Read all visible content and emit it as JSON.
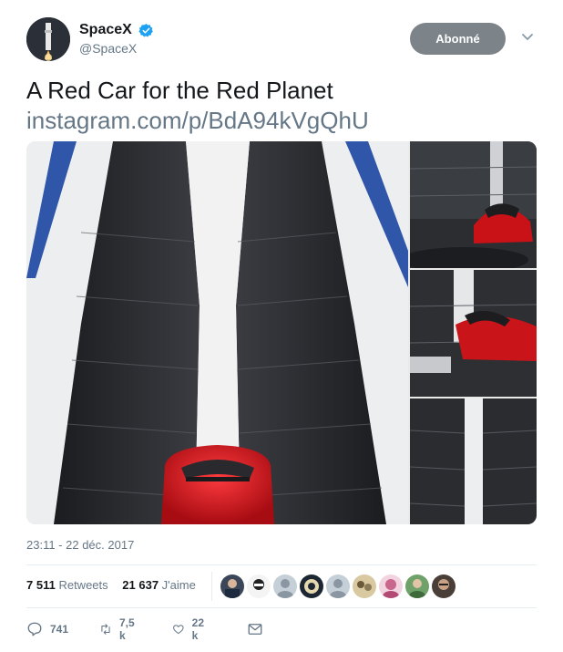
{
  "header": {
    "display_name": "SpaceX",
    "handle": "@SpaceX",
    "follow_label": "Abonné",
    "verified": true
  },
  "tweet": {
    "text": "A Red Car for the Red Planet",
    "link": "instagram.com/p/BdA94kVgQhU",
    "timestamp": "23:11 - 22 déc. 2017"
  },
  "stats": {
    "retweets_count": "7 511",
    "retweets_label": "Retweets",
    "likes_count": "21 637",
    "likes_label": "J'aime"
  },
  "actions": {
    "reply_count": "741",
    "retweet_count": "7,5 k",
    "like_count": "22 k"
  },
  "colors": {
    "follow_bg": "#7c8389",
    "verified": "#1da1f2",
    "secondary_text": "#657786",
    "car_red": "#d1141b"
  },
  "icons": {
    "verified": "verified-badge-icon",
    "chevron": "chevron-down-icon",
    "reply": "reply-icon",
    "retweet": "retweet-icon",
    "like": "heart-icon",
    "dm": "envelope-icon"
  }
}
